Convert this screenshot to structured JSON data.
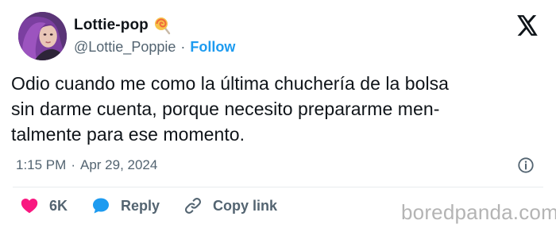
{
  "author": {
    "display_name": "Lottie-pop",
    "handle": "@Lottie_Poppie",
    "separator": "·",
    "follow_label": "Follow",
    "badge_icon": "lollipop-icon"
  },
  "tweet": {
    "text_lines": [
      "Odio cuando me como la última chuchería de la bolsa",
      "sin darme cuenta, porque necesito prepararme men-",
      "talmente para ese momento."
    ],
    "time": "1:15 PM",
    "separator": "·",
    "date": "Apr 29, 2024"
  },
  "actions": {
    "likes_count": "6K",
    "reply_label": "Reply",
    "copy_link_label": "Copy link"
  },
  "watermark": "boredpanda.com",
  "colors": {
    "accent": "#1d9bf0",
    "like": "#f91880",
    "text": "#0f1419",
    "muted": "#536471"
  }
}
